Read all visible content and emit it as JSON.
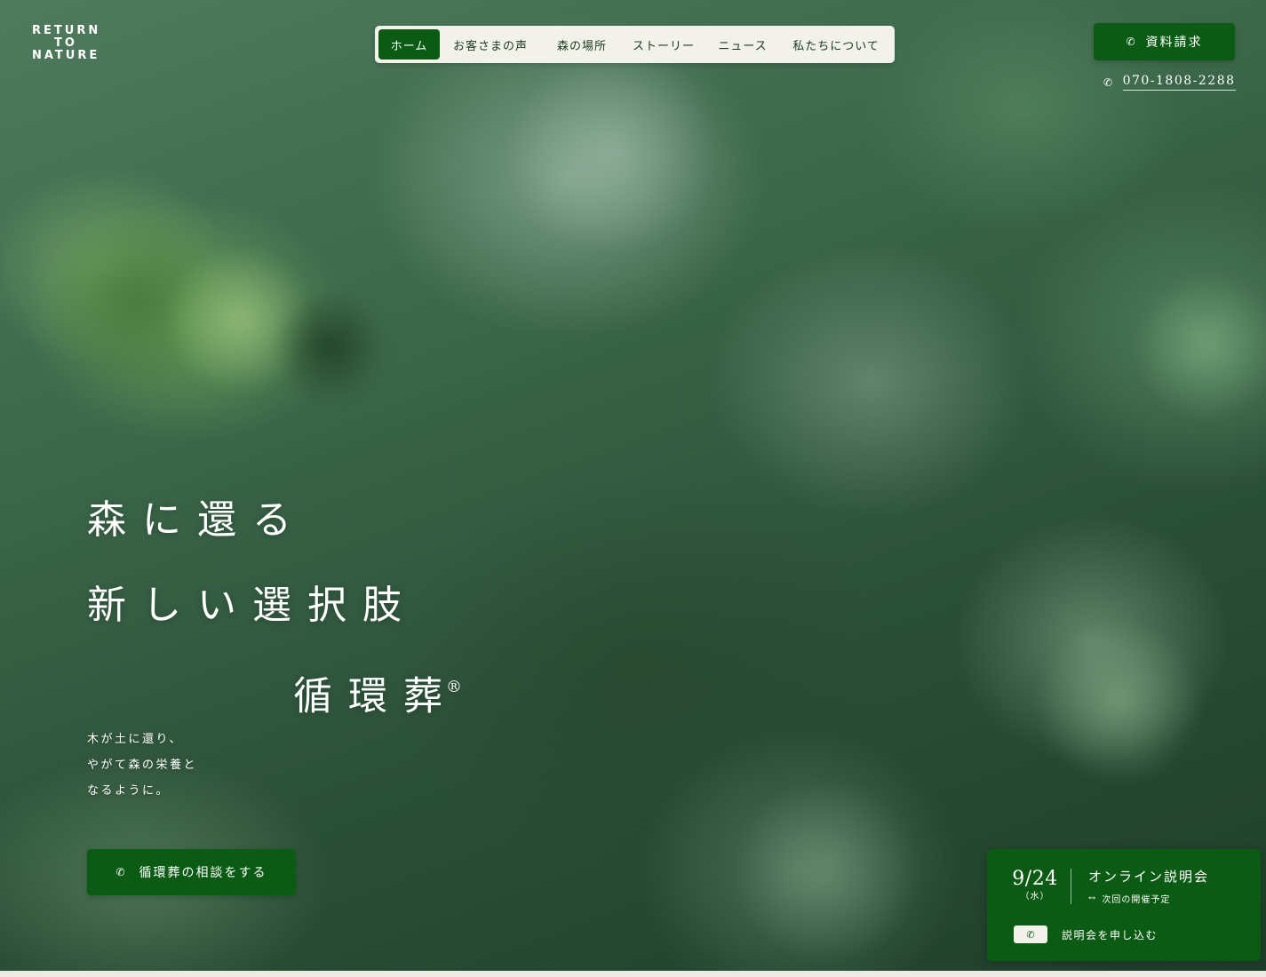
{
  "logo": {
    "line1": "RETURN",
    "line2": "TO",
    "line3": "NATURE"
  },
  "nav": {
    "items": [
      {
        "label": "ホーム",
        "active": true
      },
      {
        "label": "お客さまの声",
        "active": false
      },
      {
        "label": "森の場所",
        "active": false
      },
      {
        "label": "ストーリー",
        "active": false
      },
      {
        "label": "ニュース",
        "active": false
      },
      {
        "label": "私たちについて",
        "active": false
      }
    ]
  },
  "header": {
    "request_label": "資料請求",
    "phone_number": "070-1808-2288",
    "phone_icon": "✆"
  },
  "hero": {
    "line1": "森に還る",
    "line2": "新しい選択肢",
    "line3": "循環葬",
    "registered_mark": "®",
    "sub_line1": "木が土に還り、",
    "sub_line2": "やがて森の栄養と",
    "sub_line3": "なるように。",
    "consult_label": "循環葬の相談をする"
  },
  "event": {
    "date": "9/24",
    "day_of_week": "（水）",
    "title": "オンライン説明会",
    "subtitle": "次回の開催予定",
    "subtitle_marker": "↔",
    "apply_label": "説明会を申し込む"
  },
  "colors": {
    "brand_green": "#0c5b14",
    "nav_bg": "#f2f1ea"
  }
}
